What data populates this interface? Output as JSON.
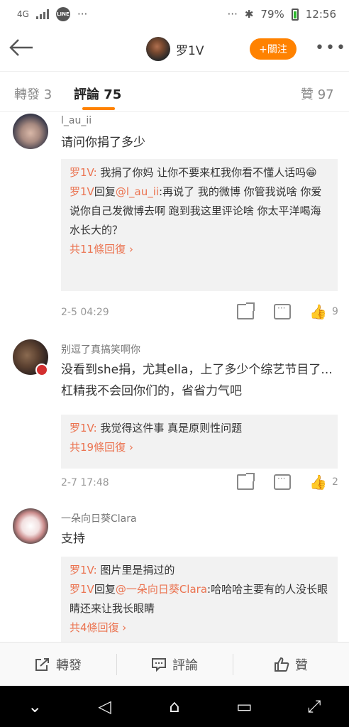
{
  "status_bar": {
    "network": "4G",
    "battery": "79%",
    "time": "12:56",
    "dots": "···"
  },
  "header": {
    "title": "罗1V",
    "follow": "+關注",
    "more": "•••"
  },
  "tabs": {
    "reposts": "轉發 3",
    "comments": "評論 75",
    "likes": "贊 97"
  },
  "comments": [
    {
      "name": "l_au_ii",
      "text": "请问你捐了多少",
      "replies": [
        {
          "name": "罗1V:",
          "text": " 我捐了你妈 让你不要来杠我你看不懂人话吗😁"
        },
        {
          "name": "罗1V",
          "prefix": "回复",
          "mention": "@l_au_ii",
          "text": ":再说了 我的微博 你管我说啥 你爱说你自己发微博去啊 跑到我这里评论啥 你太平洋喝海水长大的？"
        }
      ],
      "more_replies": "共11條回復 ›",
      "date": "2-5 04:29",
      "likes": "9"
    },
    {
      "name": "别逗了真搞笑啊你",
      "text": "没看到she捐，尤其ella，上了多少个综艺节目了...杠精我不会回你们的，省省力气吧",
      "replies": [
        {
          "name": "罗1V:",
          "text": " 我觉得这件事 真是原则性问题"
        }
      ],
      "more_replies": "共19條回復 ›",
      "date": "2-7 17:48",
      "likes": "2"
    },
    {
      "name": "一朵向日葵Clara",
      "text": "支持",
      "replies": [
        {
          "name": "罗1V:",
          "text": " 图片里是捐过的"
        },
        {
          "name": "罗1V",
          "prefix": "回复",
          "mention": "@一朵向日葵Clara",
          "text": ":哈哈哈主要有的人没长眼睛还来让我长眼睛"
        }
      ],
      "more_replies": "共4條回復 ›"
    }
  ],
  "bottom_bar": {
    "repost": "轉發",
    "comment": "評論",
    "like": "贊"
  },
  "navbar": {
    "down": "⌄",
    "back": "◁",
    "home": "⌂",
    "recent": "▭",
    "expand": "⤢"
  },
  "colors": {
    "accent": "#ff8200",
    "link": "#eb7350"
  }
}
